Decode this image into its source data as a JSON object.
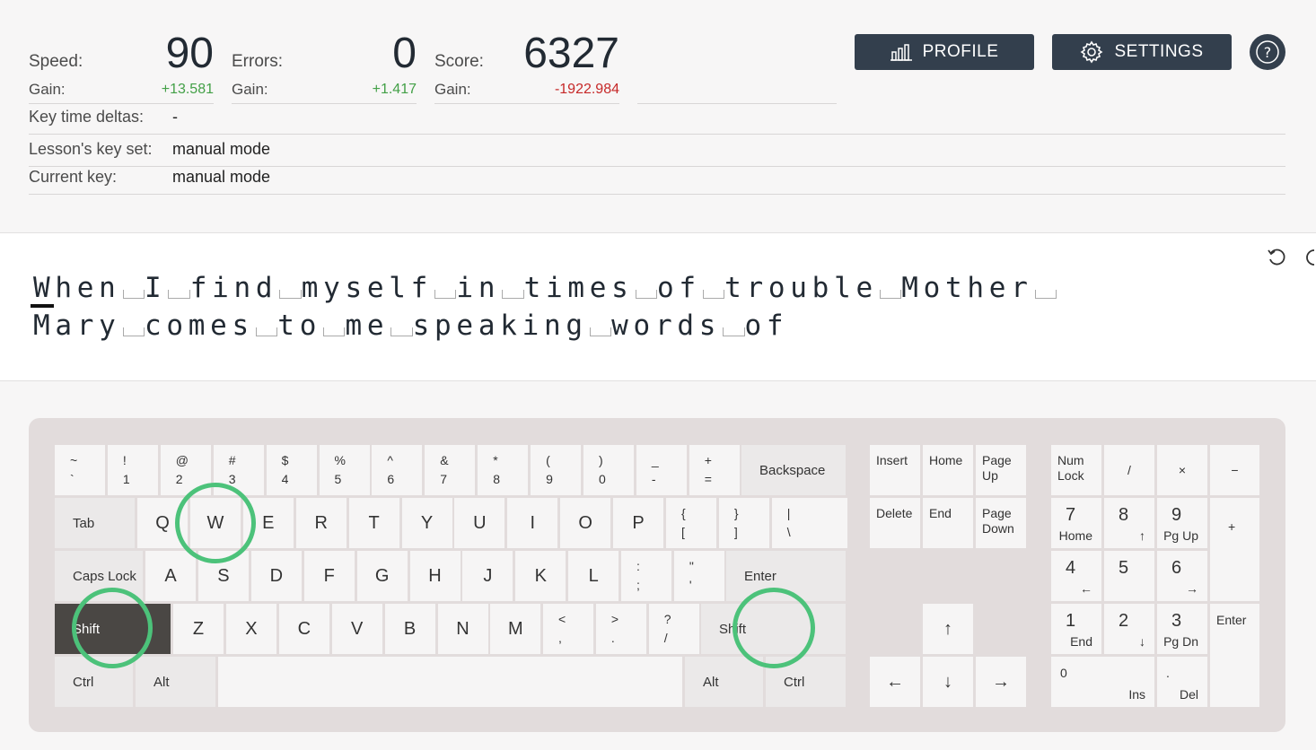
{
  "stats": {
    "speed": {
      "label": "Speed:",
      "value": "90",
      "gain_label": "Gain:",
      "gain": "+13.581"
    },
    "errors": {
      "label": "Errors:",
      "value": "0",
      "gain_label": "Gain:",
      "gain": "+1.417"
    },
    "score": {
      "label": "Score:",
      "value": "6327",
      "gain_label": "Gain:",
      "gain": "-1922.984"
    }
  },
  "info": {
    "key_time_deltas": {
      "label": "Key time deltas:",
      "value": "-"
    },
    "lesson_key_set": {
      "label": "Lesson's key set:",
      "value": "manual mode"
    },
    "current_key": {
      "label": "Current key:",
      "value": "manual mode"
    }
  },
  "buttons": {
    "profile": "PROFILE",
    "settings": "SETTINGS",
    "help": "?"
  },
  "text": {
    "line1": "When I find myself in times of trouble Mother ",
    "line2": "Mary comes to me speaking words of"
  },
  "colors": {
    "accent": "#333f4d",
    "highlight": "#4cc27a",
    "gain_positive": "#43a047",
    "gain_negative": "#c62828"
  },
  "keyboard": {
    "row1": [
      {
        "t": "~",
        "b": "`"
      },
      {
        "t": "!",
        "b": "1"
      },
      {
        "t": "@",
        "b": "2"
      },
      {
        "t": "#",
        "b": "3"
      },
      {
        "t": "$",
        "b": "4"
      },
      {
        "t": "%",
        "b": "5"
      },
      {
        "t": "^",
        "b": "6"
      },
      {
        "t": "&",
        "b": "7"
      },
      {
        "t": "*",
        "b": "8"
      },
      {
        "t": "(",
        "b": "9"
      },
      {
        "t": ")",
        "b": "0"
      },
      {
        "t": "_",
        "b": "-"
      },
      {
        "t": "+",
        "b": "="
      }
    ],
    "backspace": "Backspace",
    "tab": "Tab",
    "row2": [
      "Q",
      "W",
      "E",
      "R",
      "T",
      "Y",
      "U",
      "I",
      "O",
      "P"
    ],
    "row2_sym": [
      {
        "t": "{",
        "b": "["
      },
      {
        "t": "}",
        "b": "]"
      },
      {
        "t": "|",
        "b": "\\"
      }
    ],
    "caps": "Caps Lock",
    "row3": [
      "A",
      "S",
      "D",
      "F",
      "G",
      "H",
      "J",
      "K",
      "L"
    ],
    "row3_sym": [
      {
        "t": ":",
        "b": ";"
      },
      {
        "t": "\"",
        "b": "'"
      }
    ],
    "enter": "Enter",
    "shift_left": "Shift",
    "row4": [
      "Z",
      "X",
      "C",
      "V",
      "B",
      "N",
      "M"
    ],
    "row4_sym": [
      {
        "t": "<",
        "b": ","
      },
      {
        "t": ">",
        "b": "."
      },
      {
        "t": "?",
        "b": "/"
      }
    ],
    "shift_right": "Shift",
    "ctrl": "Ctrl",
    "alt": "Alt",
    "nav": {
      "insert": "Insert",
      "home": "Home",
      "page_up": "Page\nUp",
      "delete": "Delete",
      "end": "End",
      "page_down": "Page\nDown"
    },
    "arrows": {
      "up": "↑",
      "left": "←",
      "down": "↓",
      "right": "→"
    },
    "numpad": {
      "numlock": "Num\nLock",
      "div": "/",
      "mul": "×",
      "minus": "−",
      "plus": "+",
      "enter": "Enter",
      "n7": {
        "t": "7",
        "b": "Home"
      },
      "n8": {
        "t": "8",
        "b": "↑"
      },
      "n9": {
        "t": "9",
        "b": "Pg Up"
      },
      "n4": {
        "t": "4",
        "b": "←"
      },
      "n5": {
        "t": "5",
        "b": ""
      },
      "n6": {
        "t": "6",
        "b": "→"
      },
      "n1": {
        "t": "1",
        "b": "End"
      },
      "n2": {
        "t": "2",
        "b": "↓"
      },
      "n3": {
        "t": "3",
        "b": "Pg Dn"
      },
      "n0": {
        "t": "0",
        "b": "Ins"
      },
      "ndot": {
        "t": ".",
        "b": "Del"
      }
    }
  }
}
